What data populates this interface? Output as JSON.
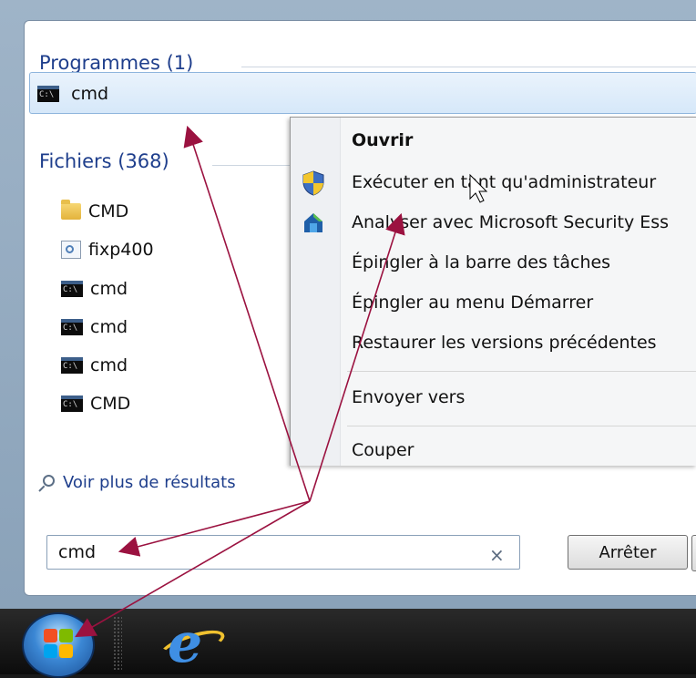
{
  "start_menu": {
    "programs_header": "Programmes (1)",
    "program_results": [
      {
        "label": "cmd",
        "icon": "cmd-icon"
      }
    ],
    "files_header": "Fichiers (368)",
    "file_results": [
      {
        "label": "CMD",
        "icon": "folder-icon"
      },
      {
        "label": "fixp400",
        "icon": "file-icon"
      },
      {
        "label": "cmd",
        "icon": "cmd-icon"
      },
      {
        "label": "cmd",
        "icon": "cmd-icon"
      },
      {
        "label": "cmd",
        "icon": "cmd-icon"
      },
      {
        "label": "CMD",
        "icon": "cmd-icon"
      }
    ],
    "more_results": "Voir plus de résultats",
    "search": {
      "value": "cmd",
      "clear": "×"
    },
    "stop_button": "Arrêter"
  },
  "context_menu": {
    "items": [
      {
        "label": "Ouvrir",
        "icon": ""
      },
      {
        "label": "Exécuter en tant qu'administrateur",
        "icon": "uac-shield-icon"
      },
      {
        "label": "Analyser avec Microsoft Security Ess",
        "icon": "security-essentials-icon"
      },
      {
        "label": "Épingler à la barre des tâches",
        "icon": ""
      },
      {
        "label": "Épingler au menu Démarrer",
        "icon": ""
      },
      {
        "label": "Restaurer les versions précédentes",
        "icon": ""
      },
      {
        "label": "Envoyer vers",
        "icon": ""
      },
      {
        "label": "Couper",
        "icon": ""
      }
    ]
  },
  "colors": {
    "annotation_arrow": "#9b1240",
    "header_blue": "#1e3e8c",
    "highlight_bg": "#d6e8f9"
  }
}
